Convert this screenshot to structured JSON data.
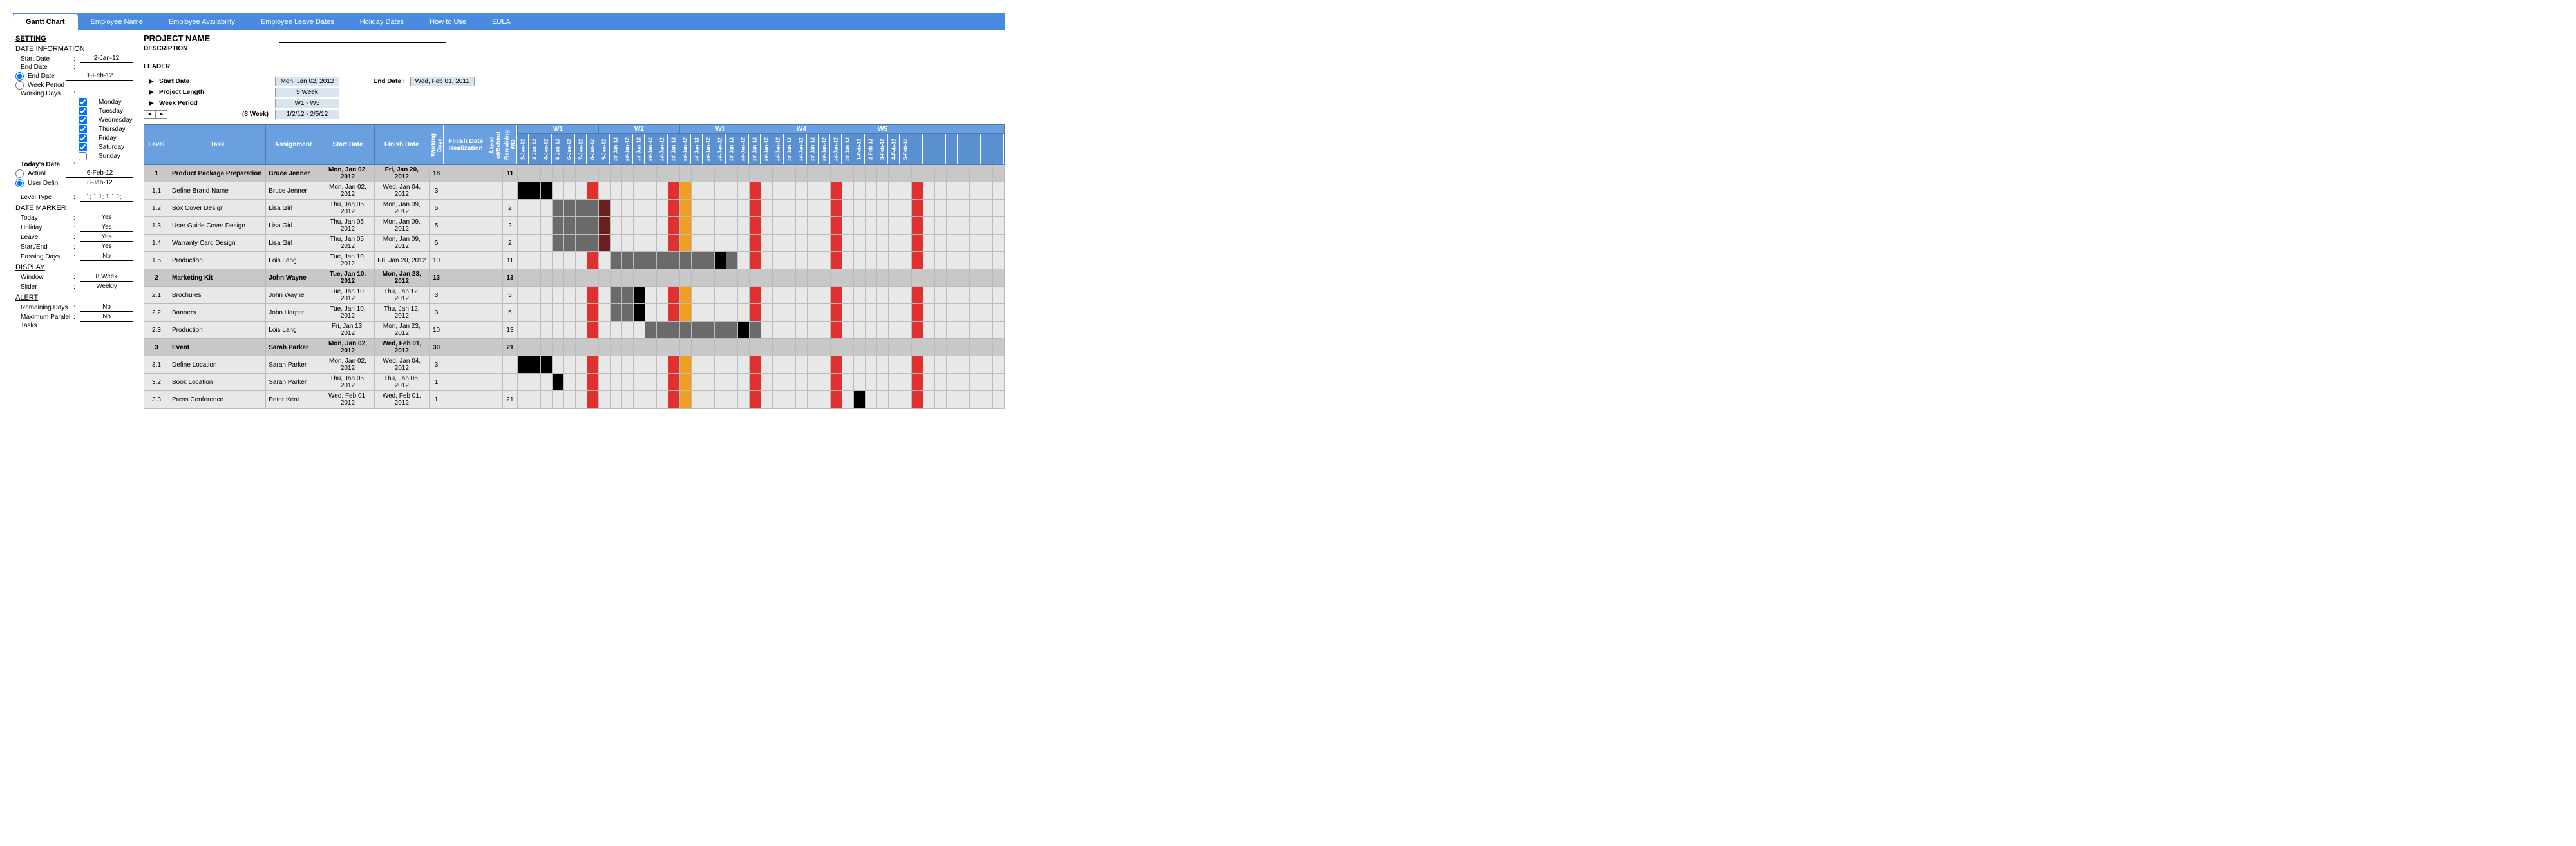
{
  "tabs": [
    "Gantt Chart",
    "Employee Name",
    "Employee Availability",
    "Employee Leave Dates",
    "Holiday Dates",
    "How to Use",
    "EULA"
  ],
  "sidebar": {
    "setting": "SETTING",
    "date_info": "DATE INFORMATION",
    "start_date_lbl": "Start Date",
    "start_date": "2-Jan-12",
    "end_date_lbl": "End Date",
    "end_date_opt": "End Date",
    "end_date": "1-Feb-12",
    "week_period_opt": "Week Period",
    "working_days_lbl": "Working Days",
    "days": [
      "Monday",
      "Tuesday",
      "Wednesday",
      "Thursday",
      "Friday",
      "Saturday",
      "Sunday"
    ],
    "todays_date_lbl": "Today's Date",
    "actual_opt": "Actual",
    "actual_val": "6-Feb-12",
    "user_defin_opt": "User Defin",
    "user_defin_val": "8-Jan-12",
    "level_type_lbl": "Level Type",
    "level_type": "1; 1.1; 1.1.1; ..",
    "date_marker": "DATE MARKER",
    "today_lbl": "Today",
    "today": "Yes",
    "holiday_lbl": "Holiday",
    "holiday": "Yes",
    "leave_lbl": "Leave",
    "leave": "Yes",
    "startend_lbl": "Start/End",
    "startend": "Yes",
    "passing_lbl": "Passing Days",
    "passing": "No",
    "display": "DISPLAY",
    "window_lbl": "Window",
    "window": "8 Week",
    "slider_lbl": "Slider",
    "slider": "Weekly",
    "alert": "ALERT",
    "remaining_lbl": "Remaining Days",
    "remaining": "No",
    "max_parallel_lbl": "Maximum Paralel",
    "max_parallel": "No",
    "tasks_lbl": "Tasks"
  },
  "header": {
    "project_name": "PROJECT NAME",
    "description": "DESCRIPTION",
    "leader": "LEADER",
    "start_date_lbl": "Start Date",
    "start_date": "Mon, Jan 02, 2012",
    "end_date_lbl": "End Date :",
    "end_date": "Wed, Feb 01, 2012",
    "project_length_lbl": "Project Length",
    "project_length": "5 Week",
    "week_period_lbl": "Week Period",
    "week_period": "W1 - W5",
    "eight_week": "(8 Week)",
    "date_range": "1/2/12 - 2/5/12"
  },
  "columns": {
    "level": "Level",
    "task": "Task",
    "assignment": "Assignment",
    "start": "Start Date",
    "finish": "Finish Date",
    "wd": "Working Days",
    "realization": "Finish Date Realization",
    "ahead": "Ahead of/Behind",
    "rwd": "Remaining WD"
  },
  "weeks": [
    "W1",
    "W2",
    "W3",
    "W4",
    "W5"
  ],
  "date_cols": [
    "2-Jan-12",
    "3-Jan-12",
    "4-Jan-12",
    "5-Jan-12",
    "6-Jan-12",
    "7-Jan-12",
    "8-Jan-12",
    "9-Jan-12",
    "##-Jan-12",
    "##-Jan-12",
    "##-Jan-12",
    "##-Jan-12",
    "##-Jan-12",
    "##-Jan-12",
    "##-Jan-12",
    "##-Jan-12",
    "##-Jan-12",
    "##-Jan-12",
    "##-Jan-12",
    "##-Jan-12",
    "##-Jan-12",
    "##-Jan-12",
    "##-Jan-12",
    "##-Jan-12",
    "##-Jan-12",
    "##-Jan-12",
    "##-Jan-12",
    "##-Jan-12",
    "##-Jan-12",
    "1-Feb-12",
    "2-Feb-12",
    "3-Feb-12",
    "4-Feb-12",
    "5-Feb-12"
  ],
  "rows": [
    {
      "level": "1",
      "task": "Product Package Preparation",
      "assign": "Bruce Jenner",
      "start": "Mon, Jan 02, 2012",
      "finish": "Fri, Jan 20, 2012",
      "wd": "18",
      "rwd": "11",
      "summary": true,
      "bars": [
        [
          0,
          18,
          "dark"
        ]
      ]
    },
    {
      "level": "1.1",
      "task": "Define Brand Name",
      "assign": "Bruce Jenner",
      "start": "Mon, Jan 02, 2012",
      "finish": "Wed, Jan 04, 2012",
      "wd": "3",
      "rwd": "",
      "bars": [
        [
          0,
          3,
          "black"
        ]
      ]
    },
    {
      "level": "1.2",
      "task": "Box Cover Design",
      "assign": "Lisa Girl",
      "start": "Thu, Jan 05, 2012",
      "finish": "Mon, Jan 09, 2012",
      "wd": "5",
      "rwd": "2",
      "bars": [
        [
          3,
          5,
          "mid"
        ],
        [
          7,
          1,
          "maroon"
        ]
      ]
    },
    {
      "level": "1.3",
      "task": "User Guide Cover Design",
      "assign": "Lisa Girl",
      "start": "Thu, Jan 05, 2012",
      "finish": "Mon, Jan 09, 2012",
      "wd": "5",
      "rwd": "2",
      "bars": [
        [
          3,
          5,
          "mid"
        ],
        [
          7,
          1,
          "maroon"
        ]
      ]
    },
    {
      "level": "1.4",
      "task": "Warranty Card Design",
      "assign": "Lisa Girl",
      "start": "Thu, Jan 05, 2012",
      "finish": "Mon, Jan 09, 2012",
      "wd": "5",
      "rwd": "2",
      "bars": [
        [
          3,
          5,
          "mid"
        ],
        [
          7,
          1,
          "maroon"
        ]
      ]
    },
    {
      "level": "1.5",
      "task": "Production",
      "assign": "Lois Lang",
      "start": "Tue, Jan 10, 2012",
      "finish": "Fri, Jan 20, 2012",
      "wd": "10",
      "rwd": "11",
      "bars": [
        [
          8,
          11,
          "mid"
        ],
        [
          17,
          1,
          "black"
        ]
      ]
    },
    {
      "level": "2",
      "task": "Marketing Kit",
      "assign": "John Wayne",
      "start": "Tue, Jan 10, 2012",
      "finish": "Mon, Jan 23, 2012",
      "wd": "13",
      "rwd": "13",
      "summary": true,
      "bars": [
        [
          8,
          13,
          "dark"
        ]
      ]
    },
    {
      "level": "2.1",
      "task": "Brochures",
      "assign": "John Wayne",
      "start": "Tue, Jan 10, 2012",
      "finish": "Thu, Jan 12, 2012",
      "wd": "3",
      "rwd": "5",
      "bars": [
        [
          8,
          3,
          "mid"
        ],
        [
          10,
          1,
          "black"
        ]
      ]
    },
    {
      "level": "2.2",
      "task": "Banners",
      "assign": "John Harper",
      "start": "Tue, Jan 10, 2012",
      "finish": "Thu, Jan 12, 2012",
      "wd": "3",
      "rwd": "5",
      "bars": [
        [
          8,
          3,
          "mid"
        ],
        [
          10,
          1,
          "black"
        ]
      ]
    },
    {
      "level": "2.3",
      "task": "Production",
      "assign": "Lois Lang",
      "start": "Fri, Jan 13, 2012",
      "finish": "Mon, Jan 23, 2012",
      "wd": "10",
      "rwd": "13",
      "bars": [
        [
          11,
          10,
          "mid"
        ],
        [
          19,
          1,
          "black"
        ]
      ]
    },
    {
      "level": "3",
      "task": "Event",
      "assign": "Sarah Parker",
      "start": "Mon, Jan 02, 2012",
      "finish": "Wed, Feb 01, 2012",
      "wd": "30",
      "rwd": "21",
      "summary": true,
      "bars": [
        [
          0,
          30,
          "dark"
        ]
      ]
    },
    {
      "level": "3.1",
      "task": "Define Location",
      "assign": "Sarah Parker",
      "start": "Mon, Jan 02, 2012",
      "finish": "Wed, Jan 04, 2012",
      "wd": "3",
      "rwd": "",
      "bars": [
        [
          0,
          3,
          "black"
        ]
      ]
    },
    {
      "level": "3.2",
      "task": "Book Location",
      "assign": "Sarah Parker",
      "start": "Thu, Jan 05, 2012",
      "finish": "Thu, Jan 05, 2012",
      "wd": "1",
      "rwd": "",
      "bars": [
        [
          3,
          1,
          "black"
        ]
      ]
    },
    {
      "level": "3.3",
      "task": "Press Conference",
      "assign": "Peter Kent",
      "start": "Wed, Feb 01, 2012",
      "finish": "Wed, Feb 01, 2012",
      "wd": "1",
      "rwd": "21",
      "bars": [
        [
          29,
          1,
          "black"
        ]
      ]
    }
  ],
  "markers": {
    "red_cols": [
      6,
      13,
      20,
      27,
      34
    ],
    "orange_col": 14
  }
}
